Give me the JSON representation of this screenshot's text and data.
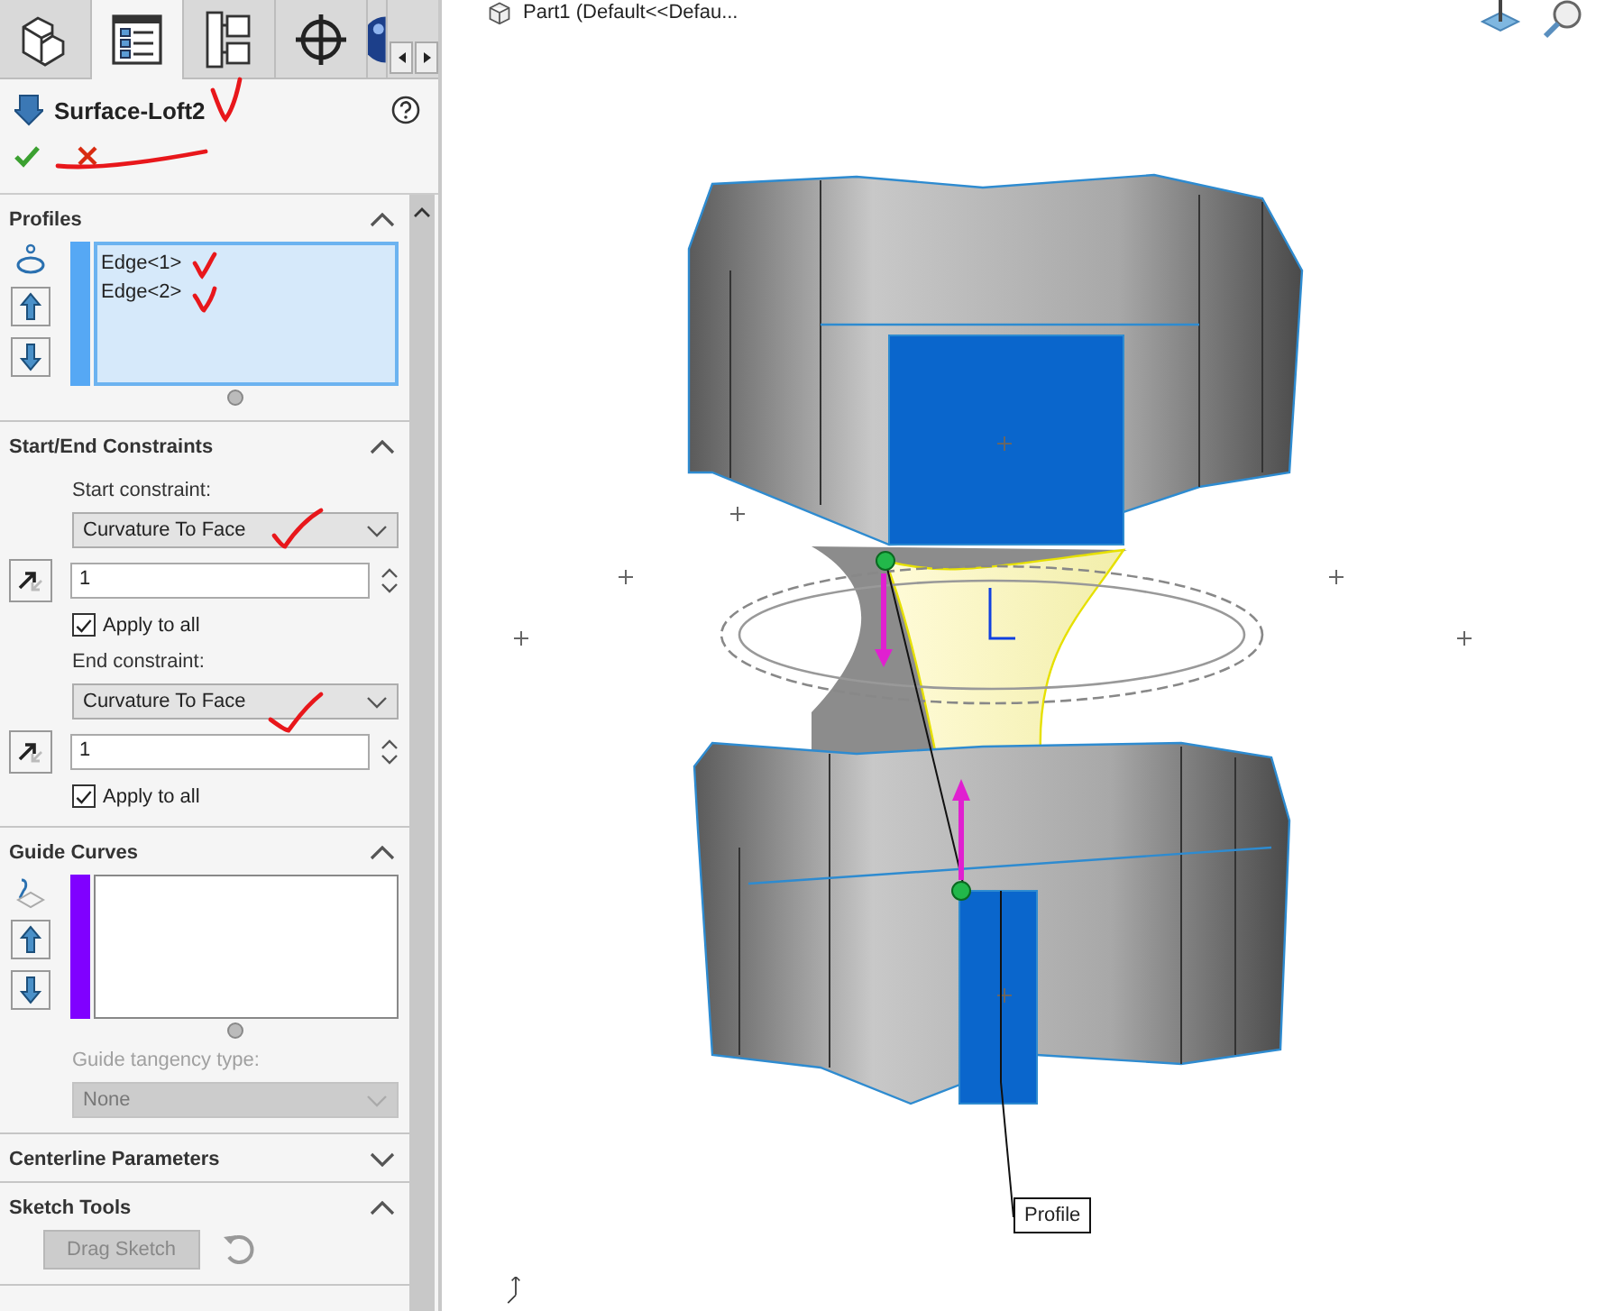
{
  "tabs": [
    {
      "kind": "part",
      "selected": false
    },
    {
      "kind": "property",
      "selected": true
    },
    {
      "kind": "config",
      "selected": false
    },
    {
      "kind": "target",
      "selected": false
    },
    {
      "kind": "appearance",
      "selected": false
    }
  ],
  "feature": {
    "title": "Surface-Loft2"
  },
  "sections": [
    {
      "kind": "profiles",
      "title": "Profiles",
      "expanded": true,
      "items": [
        "Edge<1>",
        "Edge<2>"
      ]
    },
    {
      "kind": "constraints",
      "title": "Start/End Constraints",
      "expanded": true,
      "groups": [
        {
          "label": "Start constraint:",
          "value": "Curvature To Face",
          "amount": "1",
          "apply": {
            "label": "Apply to all",
            "checked": true
          }
        },
        {
          "label": "End constraint:",
          "value": "Curvature To Face",
          "amount": "1",
          "apply": {
            "label": "Apply to all",
            "checked": true
          }
        }
      ]
    },
    {
      "kind": "guides",
      "title": "Guide Curves",
      "expanded": true,
      "tangency_label": "Guide tangency type:",
      "tangency_value": "None",
      "disabled": true
    },
    {
      "title": "Centerline Parameters",
      "expanded": false
    },
    {
      "kind": "tools",
      "title": "Sketch Tools",
      "expanded": true,
      "button": {
        "label": "Drag Sketch",
        "disabled": true
      }
    }
  ],
  "viewport": {
    "doc_title": "Part1  (Default<<Defau...",
    "callout": "Profile"
  }
}
